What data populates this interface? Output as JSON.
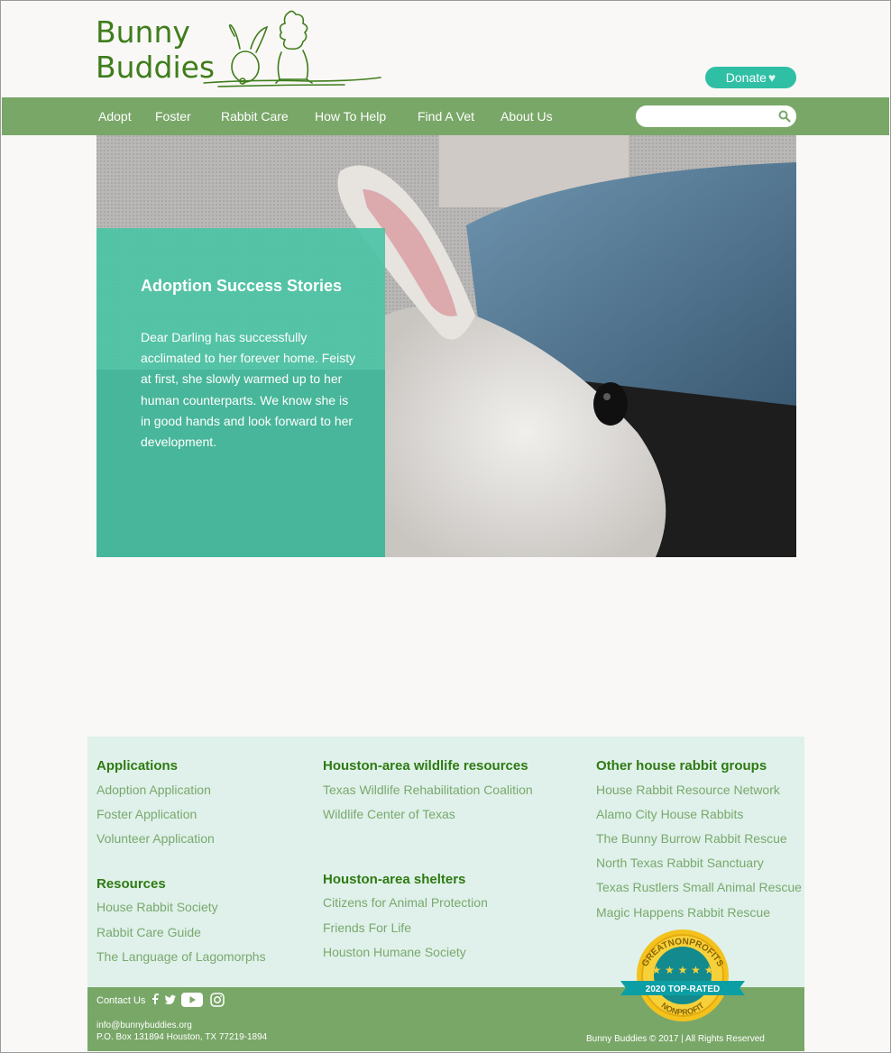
{
  "brand": {
    "line1": "Bunny",
    "line2": "Buddies"
  },
  "header": {
    "donate_label": "Donate"
  },
  "nav": {
    "items": [
      {
        "label": "Adopt"
      },
      {
        "label": "Foster"
      },
      {
        "label": "Rabbit Care"
      },
      {
        "label": "How To Help"
      },
      {
        "label": "Find A Vet"
      },
      {
        "label": "About Us"
      }
    ],
    "search_placeholder": ""
  },
  "hero": {
    "title": "Adoption Success Stories",
    "body": "Dear Darling has successfully acclimated to her forever home. Feisty at first, she slowly warmed up to her human counterparts. We know she is in good hands and look forward to her development."
  },
  "footer": {
    "applications": {
      "heading": "Applications",
      "links": [
        "Adoption Application",
        "Foster Application",
        "Volunteer Application"
      ]
    },
    "resources": {
      "heading": "Resources",
      "links": [
        "House Rabbit Society",
        "Rabbit Care Guide",
        "The Language of Lagomorphs"
      ]
    },
    "wildlife": {
      "heading": "Houston-area wildlife resources",
      "links": [
        "Texas Wildlife Rehabilitation Coalition",
        "Wildlife Center of Texas"
      ]
    },
    "shelters": {
      "heading": "Houston-area shelters",
      "links": [
        "Citizens for Animal Protection",
        "Friends For Life",
        "Houston Humane Society"
      ]
    },
    "groups": {
      "heading": "Other house rabbit groups",
      "links": [
        "House Rabbit Resource Network",
        "Alamo City House Rabbits",
        "The Bunny Burrow Rabbit Rescue",
        "North Texas Rabbit Sanctuary",
        "Texas Rustlers Small Animal Rescue",
        "Magic Happens Rabbit Rescue"
      ]
    },
    "badge": {
      "arc": "GREATNONPROFITS",
      "ribbon": "2020 TOP-RATED",
      "bottom": "NONPROFIT"
    },
    "contact_label": "Contact Us",
    "email": "info@bunnybuddies.org",
    "address": "P.O. Box 131894 Houston, TX 77219-1894",
    "copyright": "Bunny Buddies © 2017 | All Rights Reserved"
  },
  "colors": {
    "brand_green": "#3f7d1c",
    "nav_green": "#79a768",
    "teal": "#2fbfa5",
    "footer_bg": "#dff1ea"
  }
}
